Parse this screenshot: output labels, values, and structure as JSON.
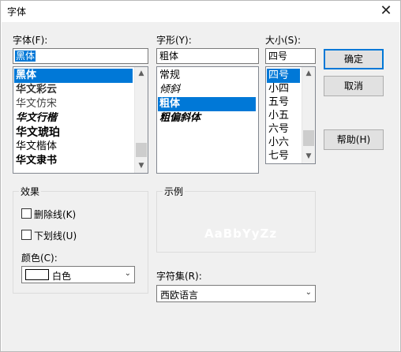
{
  "window": {
    "title": "字体",
    "close_glyph": "✕"
  },
  "font": {
    "label": "字体(F):",
    "value": "黑体",
    "items": [
      "黑体",
      "华文彩云",
      "华文仿宋",
      "华文行楷",
      "华文琥珀",
      "华文楷体",
      "华文隶书"
    ],
    "selected_index": 0
  },
  "style": {
    "label": "字形(Y):",
    "value": "粗体",
    "items": [
      "常规",
      "倾斜",
      "粗体",
      "粗偏斜体"
    ],
    "selected_index": 2
  },
  "size": {
    "label": "大小(S):",
    "value": "四号",
    "items": [
      "四号",
      "小四",
      "五号",
      "小五",
      "六号",
      "小六",
      "七号"
    ],
    "selected_index": 0
  },
  "buttons": {
    "ok": "确定",
    "cancel": "取消",
    "help": "帮助(H)"
  },
  "effects": {
    "title": "效果",
    "strikeout": "删除线(K)",
    "underline": "下划线(U)",
    "color_label": "颜色(C):",
    "color_value": "白色",
    "color_hex": "#ffffff"
  },
  "sample": {
    "title": "示例",
    "text": "AaBbYyZz"
  },
  "script": {
    "label": "字符集(R):",
    "value": "西欧语言"
  },
  "icons": {
    "scroll_up": "▲",
    "scroll_down": "▼",
    "dropdown": "⌄"
  }
}
